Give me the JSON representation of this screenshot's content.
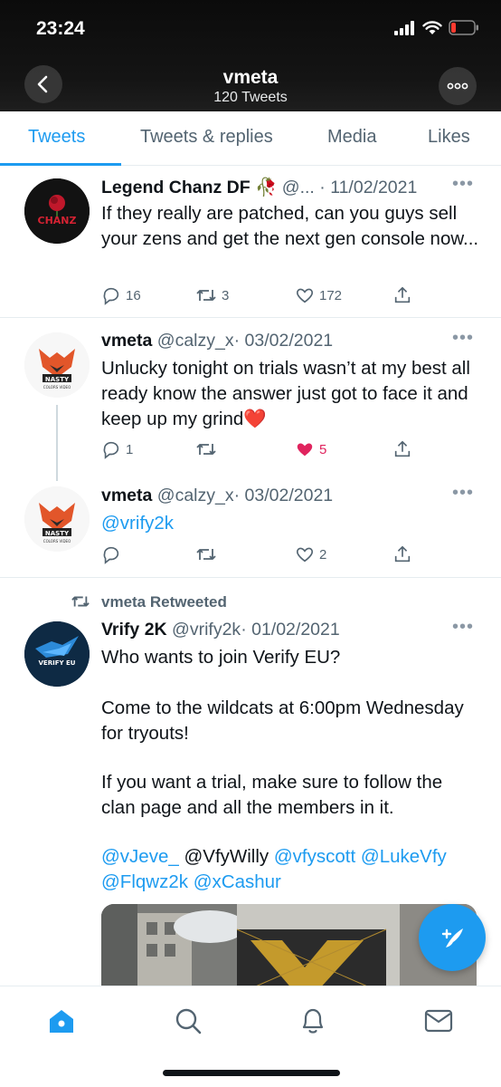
{
  "status_bar": {
    "time": "23:24"
  },
  "header": {
    "name": "vmeta",
    "tweet_count": "120 Tweets"
  },
  "tabs": [
    {
      "label": "Tweets",
      "active": true
    },
    {
      "label": "Tweets & replies",
      "active": false
    },
    {
      "label": "Media",
      "active": false
    },
    {
      "label": "Likes",
      "active": false
    }
  ],
  "tweets": [
    {
      "name": "Legend Chanz DF 🥀",
      "handle": "@...",
      "date": "· 11/02/2021",
      "text": "If they really are patched, can you guys sell your zens and get the next gen console now...",
      "replies": "16",
      "retweets": "3",
      "likes": "172"
    },
    {
      "name": "vmeta",
      "handle": "@calzy_x",
      "date": "· 03/02/2021",
      "text": "Unlucky tonight on trials wasn’t at my best all ready know the answer just got to face it and keep up my grind❤️",
      "replies": "1",
      "retweets": "",
      "likes": "5",
      "liked": true
    },
    {
      "name": "vmeta",
      "handle": "@calzy_x",
      "date": "· 03/02/2021",
      "text": "@vrify2k",
      "replies": "",
      "retweets": "",
      "likes": "2"
    },
    {
      "retweet_label": "vmeta Retweeted",
      "name": "Vrify 2K",
      "handle": "@vrify2k",
      "date": "· 01/02/2021",
      "text_line1": "Who wants to join Verify EU?",
      "text_line2": "Come to the wildcats at 6:00pm Wednesday for tryouts!",
      "text_line3": "If you want a trial, make sure to follow the clan page and all the members in it.",
      "mentions": [
        "@vJeve_",
        "@VfyWilly",
        "@vfyscott",
        "@LukeVfy",
        "@Flqwz2k",
        "@xCashur"
      ]
    }
  ],
  "avatars": {
    "chanz_text": "CHANZ",
    "vmeta_text": "NASTY",
    "vmeta_sub": "COLORS VIDEO",
    "vrify_text": "VERIFY EU"
  },
  "colors": {
    "accent": "#1d9bf0",
    "like": "#e0245e",
    "header_bg": "#111111"
  },
  "icons": [
    "back-arrow-icon",
    "more-icon",
    "reply-icon",
    "retweet-icon",
    "like-icon",
    "share-icon",
    "compose-icon",
    "home-icon",
    "search-icon",
    "notifications-icon",
    "messages-icon"
  ]
}
